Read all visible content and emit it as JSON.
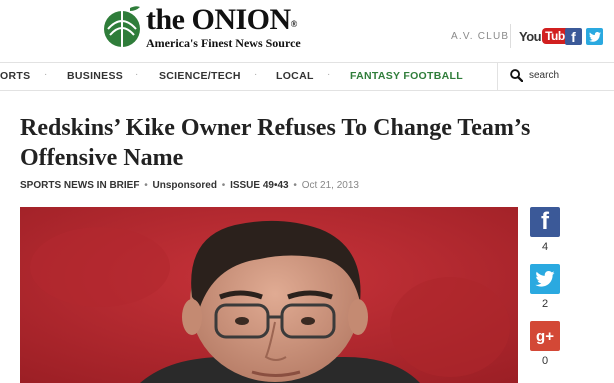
{
  "header": {
    "logo_title": "the ONION",
    "logo_reg": "®",
    "tagline": "America's Finest News Source",
    "avclub": "A.V. CLUB",
    "youtube_you": "You",
    "youtube_tube": "Tube",
    "facebook_letter": "f"
  },
  "nav": {
    "items": [
      {
        "label": "ORTS"
      },
      {
        "label": "BUSINESS"
      },
      {
        "label": "SCIENCE/TECH"
      },
      {
        "label": "LOCAL"
      },
      {
        "label": "FANTASY FOOTBALL"
      }
    ],
    "separator": "·",
    "search_label": "search"
  },
  "article": {
    "headline": "Redskins’ Kike Owner Refuses To Change Team’s Offensive Name",
    "section": "SPORTS NEWS IN BRIEF",
    "sponsor": "Unsponsored",
    "issue": "ISSUE 49•43",
    "date": "Oct 21, 2013",
    "bullet": "•"
  },
  "share": {
    "facebook": {
      "icon": "f",
      "count": "4"
    },
    "twitter": {
      "count": "2"
    },
    "googleplus": {
      "icon": "g+",
      "count": "0"
    }
  },
  "colors": {
    "brand_green": "#2f7d3a",
    "facebook": "#3b5998",
    "twitter": "#2aa9e0",
    "googleplus": "#d34836",
    "youtube_red": "#d11f1f"
  }
}
